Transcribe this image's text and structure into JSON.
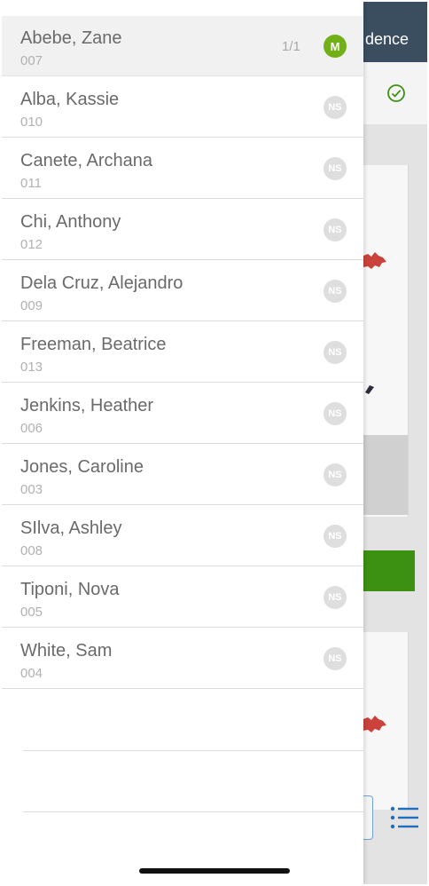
{
  "background": {
    "header_text": "dence",
    "icons": {
      "check": "check-circle-icon",
      "list": "list-icon"
    },
    "colors": {
      "header": "#3a4e5f",
      "accent_green": "#3d9112",
      "check": "#3d9112",
      "list_blue": "#1f6fc0"
    }
  },
  "students": [
    {
      "name": "Abebe, Zane",
      "code": "007",
      "count": "1/1",
      "badge": "M",
      "selected": true
    },
    {
      "name": "Alba, Kassie",
      "code": "010",
      "count": "",
      "badge": "NS"
    },
    {
      "name": "Canete, Archana",
      "code": "011",
      "count": "",
      "badge": "NS"
    },
    {
      "name": "Chi, Anthony",
      "code": "012",
      "count": "",
      "badge": "NS"
    },
    {
      "name": "Dela Cruz, Alejandro",
      "code": "009",
      "count": "",
      "badge": "NS"
    },
    {
      "name": "Freeman, Beatrice",
      "code": "013",
      "count": "",
      "badge": "NS"
    },
    {
      "name": "Jenkins, Heather",
      "code": "006",
      "count": "",
      "badge": "NS"
    },
    {
      "name": "Jones, Caroline",
      "code": "003",
      "count": "",
      "badge": "NS"
    },
    {
      "name": "SIlva, Ashley",
      "code": "008",
      "count": "",
      "badge": "NS"
    },
    {
      "name": "Tiponi, Nova",
      "code": "005",
      "count": "",
      "badge": "NS"
    },
    {
      "name": "White, Sam",
      "code": "004",
      "count": "",
      "badge": "NS"
    }
  ],
  "badge_colors": {
    "M": "#72b017",
    "NS": "#dedede"
  }
}
